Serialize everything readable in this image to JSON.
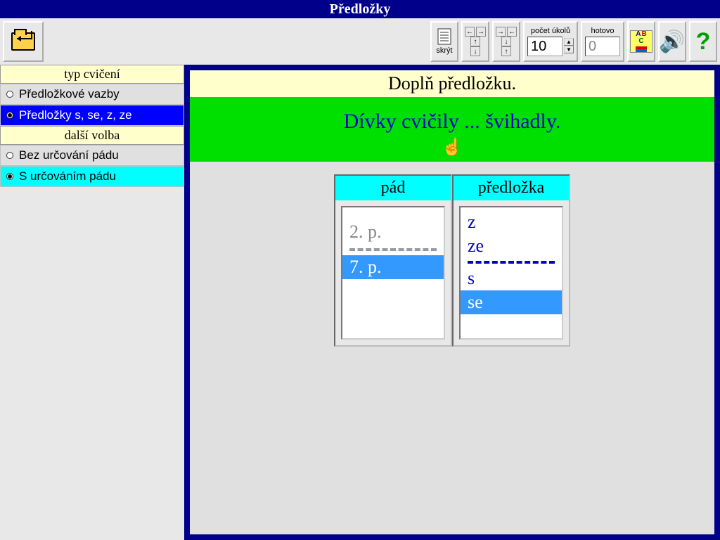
{
  "title": "Předložky",
  "toolbar": {
    "skryt_label": "skrýt",
    "pocet_label": "počet úkolů",
    "pocet_value": "10",
    "hotovo_label": "hotovo",
    "hotovo_value": "0"
  },
  "sidebar": {
    "header1": "typ cvičení",
    "opt1": {
      "label": "Předložkové vazby",
      "selected": false
    },
    "opt2": {
      "label": "Předložky s, se, z, ze",
      "selected": true
    },
    "header2": "další volba",
    "opt3": {
      "label": "Bez určování pádu",
      "selected": false
    },
    "opt4": {
      "label": "S určováním pádu",
      "selected": true
    }
  },
  "task": {
    "title": "Doplň předložku.",
    "sentence": "Dívky cvičily ... švihadly."
  },
  "columns": {
    "pad": {
      "header": "pád",
      "opts": {
        "a": "2. p.",
        "b": "7. p."
      },
      "selected": "b"
    },
    "predlozka": {
      "header": "předložka",
      "opts": {
        "a": "z",
        "b": "ze",
        "c": "s",
        "d": "se"
      },
      "selected": "d"
    }
  },
  "abc": {
    "a": "A",
    "b": "B",
    "c": "C"
  }
}
